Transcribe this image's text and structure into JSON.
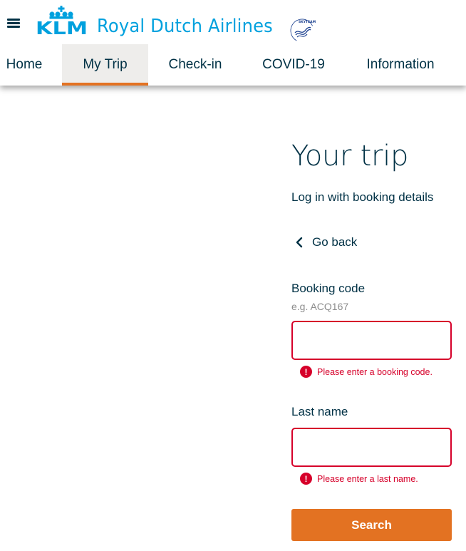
{
  "header": {
    "menu_icon": "hamburger-menu-icon",
    "logo_text": "KLM",
    "brand_name": "Royal Dutch Airlines",
    "alliance_logo": "SkyTeam",
    "colors": {
      "brand_blue": "#00a1de",
      "dark_blue": "#003145",
      "accent_orange": "#e37222",
      "active_tab_bg": "#eeedeb"
    }
  },
  "nav": {
    "items": [
      {
        "label": "Home",
        "active": false
      },
      {
        "label": "My Trip",
        "active": true
      },
      {
        "label": "Check-in",
        "active": false
      },
      {
        "label": "COVID-19",
        "active": false
      },
      {
        "label": "Information",
        "active": false
      }
    ]
  },
  "main": {
    "title": "Your trip",
    "subtitle": "Log in with booking details",
    "go_back_label": "Go back",
    "go_back_icon": "chevron-left-icon",
    "booking_code": {
      "label": "Booking code",
      "hint": "e.g. ACQ167",
      "value": "",
      "error": "Please enter a booking code."
    },
    "last_name": {
      "label": "Last name",
      "value": "",
      "error": "Please enter a last name."
    },
    "error_icon": "!",
    "error_color": "#d6002a",
    "search_label": "Search"
  }
}
